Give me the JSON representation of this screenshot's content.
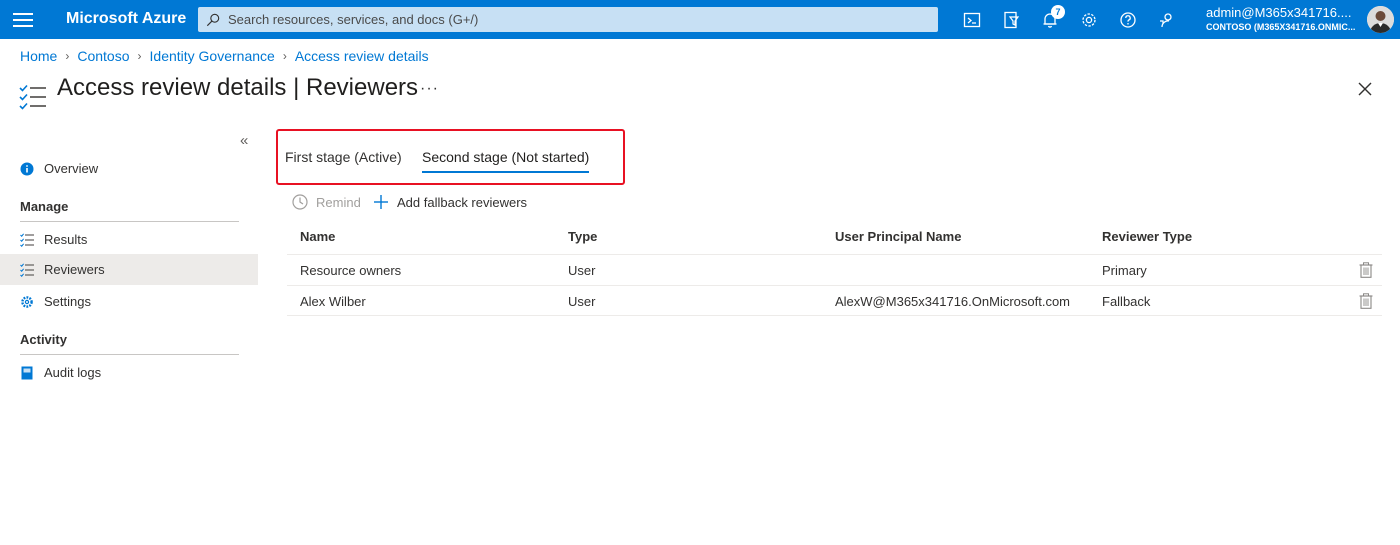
{
  "topbar": {
    "brand": "Microsoft Azure",
    "search_placeholder": "Search resources, services, and docs (G+/)",
    "notification_count": "7",
    "account_name": "admin@M365x341716....",
    "account_tenant": "CONTOSO (M365X341716.ONMIC..."
  },
  "breadcrumb": [
    "Home",
    "Contoso",
    "Identity Governance",
    "Access review details"
  ],
  "header": {
    "title": "Access review details",
    "separator": " | ",
    "subtitle": "Reviewers",
    "more_label": "···"
  },
  "sidebar": {
    "collapse_label": "«",
    "overview": "Overview",
    "manage_heading": "Manage",
    "results": "Results",
    "reviewers": "Reviewers",
    "settings": "Settings",
    "activity_heading": "Activity",
    "audit_logs": "Audit logs"
  },
  "tabs": [
    {
      "label": "First stage (Active)",
      "selected": false
    },
    {
      "label": "Second stage (Not started)",
      "selected": true
    }
  ],
  "toolbar": {
    "remind": "Remind",
    "add_fallback": "Add fallback reviewers"
  },
  "table": {
    "columns": [
      "Name",
      "Type",
      "User Principal Name",
      "Reviewer Type"
    ],
    "rows": [
      {
        "name": "Resource owners",
        "type": "User",
        "upn": "",
        "reviewer_type": "Primary"
      },
      {
        "name": "Alex Wilber",
        "type": "User",
        "upn": "AlexW@M365x341716.OnMicrosoft.com",
        "reviewer_type": "Fallback"
      }
    ]
  },
  "colors": {
    "accent": "#0078d4",
    "highlight_border": "#e81123"
  }
}
